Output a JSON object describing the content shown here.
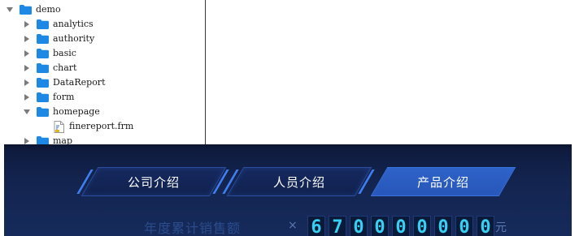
{
  "tree": {
    "root": {
      "label": "demo",
      "expanded": true
    },
    "children": [
      {
        "label": "analytics",
        "expanded": false
      },
      {
        "label": "authority",
        "expanded": false
      },
      {
        "label": "basic",
        "expanded": false
      },
      {
        "label": "chart",
        "expanded": false
      },
      {
        "label": "DataReport",
        "expanded": false
      },
      {
        "label": "form",
        "expanded": false
      },
      {
        "label": "homepage",
        "expanded": true
      },
      {
        "label": "map",
        "expanded": false
      }
    ],
    "homepage_files": [
      {
        "label": "finereport.frm",
        "icon": "frm-file-icon"
      }
    ]
  },
  "dashboard": {
    "tabs": [
      {
        "label": "公司介绍",
        "active": false
      },
      {
        "label": "人员介绍",
        "active": false
      },
      {
        "label": "产品介绍",
        "active": true
      }
    ],
    "stat": {
      "label": "年度累计销售额",
      "multiplier": "×",
      "digits": [
        "6",
        "7",
        "0",
        "0",
        "0",
        "0",
        "0",
        "0",
        "0"
      ],
      "unit": "元"
    }
  },
  "colors": {
    "folder": "#1e88e5",
    "dash_bg": "#13244f",
    "tab_active": "#2e63c9",
    "digit": "#36d0f2"
  }
}
